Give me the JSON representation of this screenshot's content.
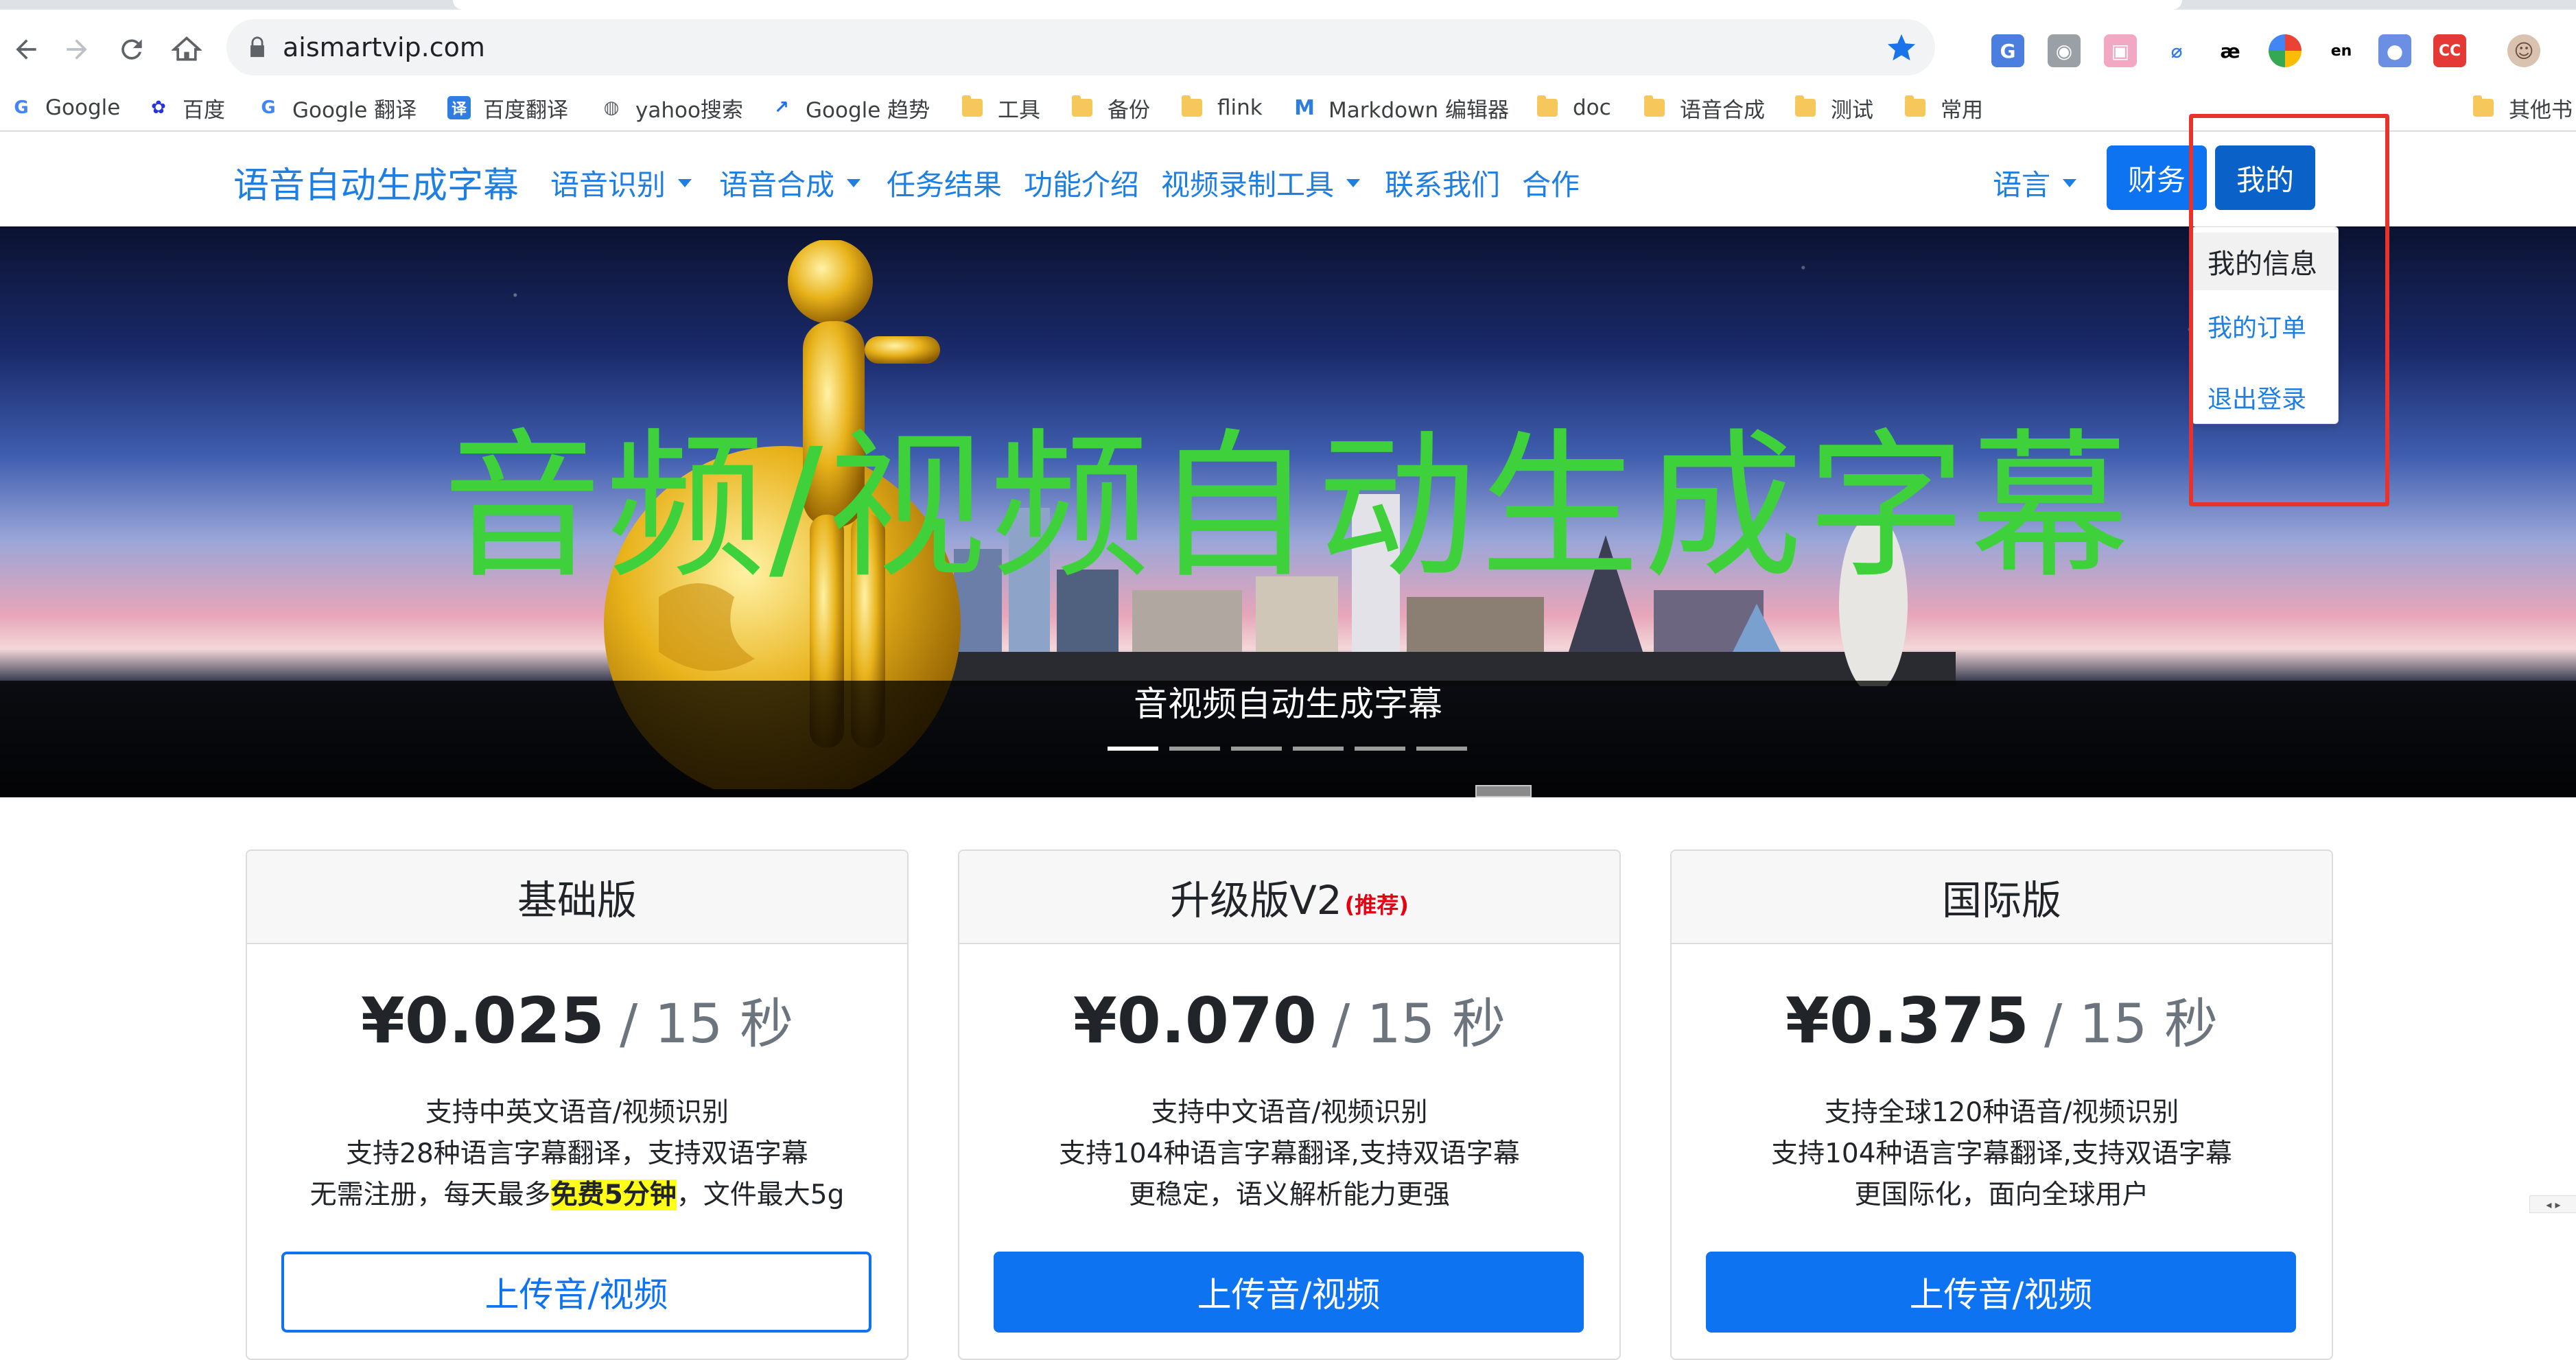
{
  "browser": {
    "url": "aismartvip.com",
    "bookmarks": [
      {
        "label": "Google",
        "icon": "google-icon"
      },
      {
        "label": "百度",
        "icon": "baidu-paw-icon"
      },
      {
        "label": "Google 翻译",
        "icon": "google-translate-icon"
      },
      {
        "label": "百度翻译",
        "icon": "baidu-translate-icon"
      },
      {
        "label": "yahoo搜索",
        "icon": "globe-icon"
      },
      {
        "label": "Google 趋势",
        "icon": "trends-icon"
      },
      {
        "label": "工具",
        "icon": "folder-icon"
      },
      {
        "label": "备份",
        "icon": "folder-icon"
      },
      {
        "label": "flink",
        "icon": "folder-icon"
      },
      {
        "label": "Markdown 编辑器",
        "icon": "markdown-icon"
      },
      {
        "label": "doc",
        "icon": "folder-icon"
      },
      {
        "label": "语音合成",
        "icon": "folder-icon"
      },
      {
        "label": "测试",
        "icon": "folder-icon"
      },
      {
        "label": "常用",
        "icon": "folder-icon"
      }
    ],
    "other_bookmarks": "其他书",
    "extensions": [
      "translate-ext-icon",
      "camera-ext-icon",
      "pink-ext-icon",
      "leaf-ext-icon",
      "ae-ext-icon",
      "chrome-ring-ext-icon",
      "en-ext-icon",
      "palette-ext-icon",
      "cc-ext-icon",
      "profile-avatar"
    ]
  },
  "nav": {
    "brand": "语音自动生成字幕",
    "items": [
      {
        "label": "语音识别",
        "dropdown": true
      },
      {
        "label": "语音合成",
        "dropdown": true
      },
      {
        "label": "任务结果",
        "dropdown": false
      },
      {
        "label": "功能介绍",
        "dropdown": false
      },
      {
        "label": "视频录制工具",
        "dropdown": true
      },
      {
        "label": "联系我们",
        "dropdown": false
      },
      {
        "label": "合作",
        "dropdown": false
      }
    ],
    "language": "语言",
    "finance_button": "财务",
    "mine_button": "我的"
  },
  "dropdown": {
    "header": "我的信息",
    "items": [
      "我的订单",
      "退出登录"
    ]
  },
  "hero": {
    "title": "音频/视频自动生成字幕",
    "caption": "音视频自动生成字幕",
    "slides": 6,
    "active_slide": 1
  },
  "plans": [
    {
      "name": "基础版",
      "badge": "",
      "price": "¥0.025",
      "unit": "/ 15 秒",
      "lines": [
        "支持中英文语音/视频识别",
        "支持28种语言字幕翻译，支持双语字幕"
      ],
      "line3_pre": "无需注册，每天最多",
      "line3_highlight": "免费5分钟",
      "line3_post": "，文件最大5g",
      "button": "上传音/视频",
      "button_style": "outline"
    },
    {
      "name": "升级版V2",
      "badge": "(推荐)",
      "price": "¥0.070",
      "unit": "/ 15 秒",
      "lines": [
        "支持中文语音/视频识别",
        "支持104种语言字幕翻译,支持双语字幕",
        "更稳定，语义解析能力更强"
      ],
      "button": "上传音/视频",
      "button_style": "solid"
    },
    {
      "name": "国际版",
      "badge": "",
      "price": "¥0.375",
      "unit": "/ 15 秒",
      "lines": [
        "支持全球120种语音/视频识别",
        "支持104种语言字幕翻译,支持双语字幕",
        "更国际化，面向全球用户"
      ],
      "button": "上传音/视频",
      "button_style": "solid"
    }
  ],
  "colors": {
    "link": "#1e7fe1",
    "primary_button": "#0d73f0",
    "hero_title": "#3fd13b",
    "annotation_box": "#e8332d",
    "highlight": "#ffff1a",
    "recommend": "#e60012"
  }
}
